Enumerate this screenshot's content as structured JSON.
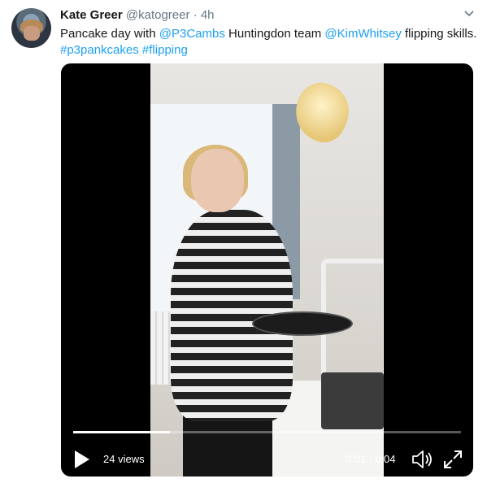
{
  "author": {
    "name": "Kate Greer",
    "handle": "@katogreer",
    "separator": "·",
    "time": "4h"
  },
  "tweet": {
    "part1": "Pancake day with ",
    "mention1": "@P3Cambs",
    "part2": " Huntingdon team ",
    "mention2": "@KimWhitsey",
    "part3": " flipping skills. ",
    "hashtag1": "#p3pankcakes",
    "part4": " ",
    "hashtag2": "#flipping"
  },
  "video": {
    "views": "24 views",
    "timecode": "0:01 / 0:04",
    "progress": 0.25,
    "controls": {
      "play": "play-icon",
      "volume": "volume-icon",
      "fullscreen": "fullscreen-icon"
    }
  },
  "menu": {
    "icon": "chevron-down-icon"
  },
  "colors": {
    "link": "#1da1f2",
    "text": "#14171a",
    "secondary": "#657786"
  }
}
